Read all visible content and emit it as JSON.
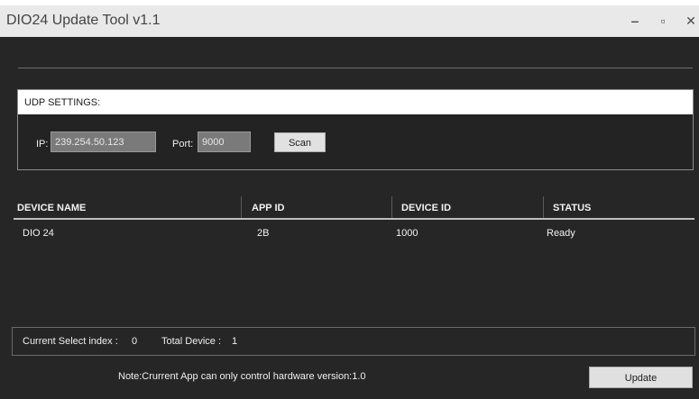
{
  "window": {
    "title": "DIO24 Update Tool v1.1",
    "controls": {
      "minimize": "‒",
      "maximize": "▫",
      "close": "✕"
    }
  },
  "udp": {
    "header": "UDP SETTINGS:",
    "ip_label": "IP:",
    "ip_value": "239.254.50.123",
    "port_label": "Port:",
    "port_value": "9000",
    "scan_label": "Scan"
  },
  "table": {
    "headers": [
      "DEVICE NAME",
      "APP ID",
      "DEVICE ID",
      "STATUS"
    ],
    "rows": [
      [
        "DIO 24",
        "2B",
        "1000",
        "Ready"
      ]
    ]
  },
  "status": {
    "select_label": "Current Select index :",
    "select_value": "0",
    "total_label": "Total Device :",
    "total_value": "1"
  },
  "footer": {
    "note": "Note:Crurrent App can only control hardware version:1.0",
    "update_label": "Update"
  }
}
